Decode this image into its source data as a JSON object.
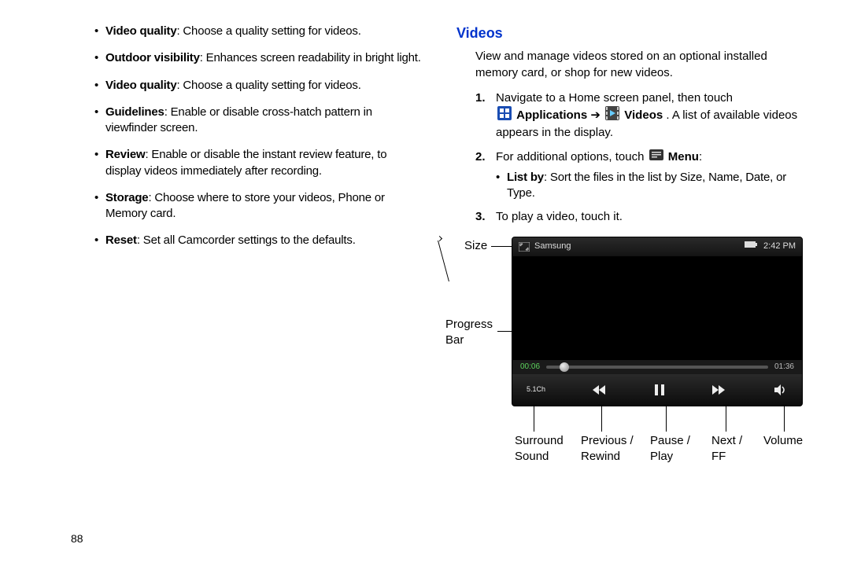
{
  "page_number": "88",
  "left_bullets": [
    {
      "term": "Video quality",
      "desc": ": Choose a quality setting for videos."
    },
    {
      "term": "Outdoor visibility",
      "desc": ": Enhances screen readability in bright light."
    },
    {
      "term": "Video quality",
      "desc": ": Choose a quality setting for videos."
    },
    {
      "term": "Guidelines",
      "desc": ": Enable or disable cross-hatch pattern in viewfinder screen."
    },
    {
      "term": "Review",
      "desc": ": Enable or disable the instant review feature, to display videos immediately after recording."
    },
    {
      "term": "Storage",
      "desc": ": Choose where to store your videos, Phone or Memory card."
    },
    {
      "term": "Reset",
      "desc": ": Set all Camcorder settings to the defaults."
    }
  ],
  "right": {
    "heading": "Videos",
    "intro": "View and manage videos stored on an optional installed memory card, or shop for new videos.",
    "step1_a": "Navigate to a Home screen panel, then touch ",
    "step1_apps": "Applications",
    "step1_arrow": " ➔ ",
    "step1_videos": "Videos",
    "step1_c": ". A list of available videos appears in the display.",
    "step2_a": "For additional options, touch ",
    "step2_menu": "Menu",
    "step2_colon": ":",
    "step2_sub_term": "List by",
    "step2_sub_desc": ": Sort the files in the list by Size, Name, Date, or Type.",
    "step3": "To play a video, touch it.",
    "num1": "1.",
    "num2": "2.",
    "num3": "3."
  },
  "player": {
    "brand": "Samsung",
    "battery": "",
    "time": "2:42 PM",
    "elapsed": "00:06",
    "duration": "01:36",
    "surround": "5.1Ch"
  },
  "callouts": {
    "size": "Size",
    "progress1": "Progress",
    "progress2": "Bar",
    "surround1": "Surround",
    "surround2": "Sound",
    "prev1": "Previous /",
    "prev2": "Rewind",
    "pause1": "Pause /",
    "pause2": "Play",
    "next1": "Next /",
    "next2": "FF",
    "volume": "Volume"
  }
}
